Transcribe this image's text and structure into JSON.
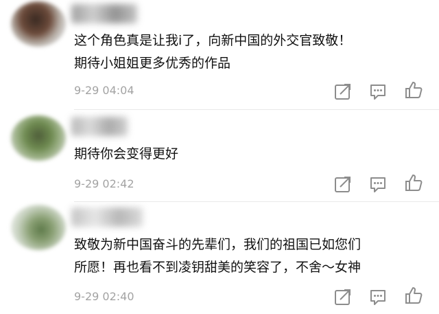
{
  "comments": [
    {
      "text_lines": [
        "这个角色真是让我i了，向新中国的外交官致敬！",
        "期待小姐姐更多优秀的作品"
      ],
      "timestamp": "9-29 04:04",
      "actions": [
        "forward-icon",
        "reply-icon",
        "like-icon"
      ]
    },
    {
      "text_lines": [
        "期待你会变得更好"
      ],
      "timestamp": "9-29 02:42",
      "actions": [
        "forward-icon",
        "reply-icon",
        "like-icon"
      ]
    },
    {
      "text_lines": [
        "致敬为新中国奋斗的先辈们，我们的祖国已如您们",
        "所愿！再也看不到凌钥甜美的笑容了，不舍～女神"
      ],
      "timestamp": "9-29 02:40",
      "actions": [
        "forward-icon",
        "reply-icon",
        "like-icon"
      ]
    }
  ],
  "colors": {
    "text": "#111111",
    "meta": "#a3a3a3",
    "icon": "#8c8c8c",
    "divider": "#e9e9e9",
    "background": "#ffffff"
  }
}
